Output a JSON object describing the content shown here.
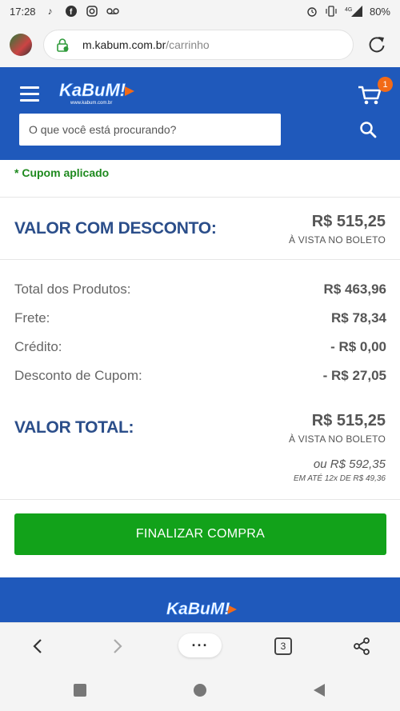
{
  "status_bar": {
    "time": "17:28",
    "battery": "80%",
    "network": "4G"
  },
  "browser": {
    "url_domain": "m.kabum.com.br",
    "url_path": "/carrinho",
    "tab_count": "3",
    "more_label": "···"
  },
  "header": {
    "logo_text": "KaBuM!",
    "logo_subtext": "www.kabum.com.br",
    "cart_count": "1",
    "search_placeholder": "O que você está procurando?"
  },
  "cart": {
    "coupon_text": "* Cupom aplicado",
    "discount_label": "VALOR COM DESCONTO:",
    "discount_value": "R$ 515,25",
    "discount_sub": "À VISTA NO BOLETO",
    "lines": [
      {
        "label": "Total dos Produtos:",
        "value": "R$ 463,96"
      },
      {
        "label": "Frete:",
        "value": "R$ 78,34"
      },
      {
        "label": "Crédito:",
        "value": "- R$ 0,00"
      },
      {
        "label": "Desconto de Cupom:",
        "value": "- R$ 27,05"
      }
    ],
    "total_label": "VALOR TOTAL:",
    "total_value": "R$ 515,25",
    "total_sub": "À VISTA NO BOLETO",
    "installment_main": "ou R$ 592,35",
    "installment_sub": "EM ATÉ 12x DE R$ 49,36",
    "finalize_label": "FINALIZAR COMPRA"
  },
  "colors": {
    "brand_blue": "#1f59bb",
    "accent_orange": "#f26a17",
    "buy_green": "#12a21a",
    "coupon_green": "#1f8a1f",
    "label_blue": "#2b4e8a"
  }
}
